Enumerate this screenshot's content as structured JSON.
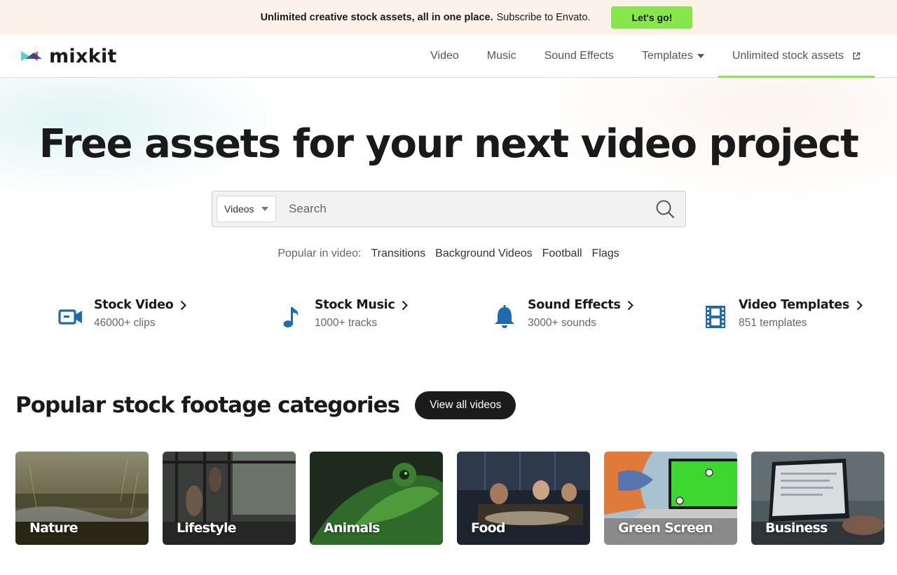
{
  "promo": {
    "bold_text": "Unlimited creative stock assets, all in one place.",
    "text": "Subscribe to Envato.",
    "button_label": "Let's go!"
  },
  "header": {
    "logo_text": "mixkit",
    "nav": [
      {
        "label": "Video"
      },
      {
        "label": "Music"
      },
      {
        "label": "Sound Effects"
      },
      {
        "label": "Templates",
        "icon": "caret-down-icon"
      },
      {
        "label": "Unlimited stock assets",
        "icon": "external-link-icon"
      }
    ]
  },
  "hero": {
    "title": "Free assets for your next video project",
    "search": {
      "type_selected": "Videos",
      "placeholder": "Search"
    },
    "popular": {
      "label": "Popular in video:",
      "tags": [
        "Transitions",
        "Background Videos",
        "Football",
        "Flags"
      ]
    }
  },
  "assets": [
    {
      "title": "Stock Video",
      "subtitle": "46000+ clips",
      "icon": "video-camera-icon"
    },
    {
      "title": "Stock Music",
      "subtitle": "1000+ tracks",
      "icon": "music-note-icon"
    },
    {
      "title": "Sound Effects",
      "subtitle": "3000+ sounds",
      "icon": "bell-icon"
    },
    {
      "title": "Video Templates",
      "subtitle": "851 templates",
      "icon": "film-strip-icon"
    }
  ],
  "categories": {
    "title": "Popular stock footage categories",
    "view_all_label": "View all videos",
    "items": [
      {
        "label": "Nature"
      },
      {
        "label": "Lifestyle"
      },
      {
        "label": "Animals"
      },
      {
        "label": "Food"
      },
      {
        "label": "Green Screen"
      },
      {
        "label": "Business"
      }
    ]
  },
  "colors": {
    "accent_green": "#87e64b",
    "icon_blue": "#1f6bb0",
    "promo_bg": "#fdf2ea",
    "dark_button": "#1b1b1b"
  }
}
